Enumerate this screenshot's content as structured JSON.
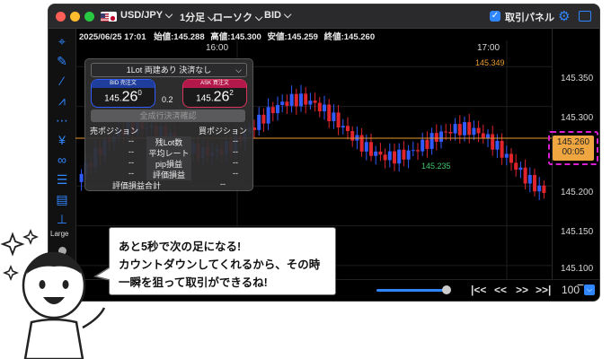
{
  "titlebar": {
    "symbol": "USD/JPY",
    "timeframe": "1分足",
    "chart_type": "ローソク",
    "price_side": "BID",
    "trade_panel_label": "取引パネル",
    "trade_panel_checked": true
  },
  "infobar": {
    "datetime": "2025/06/25 17:01",
    "open": "始値:145.288",
    "high": "高値:145.300",
    "low": "安値:145.259",
    "close": "終値:145.260"
  },
  "time_axis": [
    "16:00",
    "17:00"
  ],
  "price_axis": [
    "145.350",
    "145.300",
    "145.200",
    "145.150",
    "145.100"
  ],
  "chart_annotations": {
    "high": "145.349",
    "low": "145.235"
  },
  "current_price": {
    "price": "145.260",
    "countdown": "00:05"
  },
  "panel": {
    "mode": "1Lot 両建あり 決済なし",
    "bid_label": "BID 売注文",
    "bid_big": "145.",
    "bid_pips": "26",
    "bid_frac": "0",
    "spread": "0.2",
    "ask_label": "ASK 買注文",
    "ask_big": "145.",
    "ask_pips": "26",
    "ask_frac": "2",
    "close_all": "全成行決済確認",
    "sell_position": "売ポジション",
    "buy_position": "買ポジション",
    "rows": [
      {
        "label": "残Lot数",
        "sell": "--",
        "buy": "--"
      },
      {
        "label": "平均レート",
        "sell": "--",
        "buy": "--"
      },
      {
        "label": "pip損益",
        "sell": "--",
        "buy": "--"
      },
      {
        "label": "評価損益",
        "sell": "--",
        "buy": "--"
      }
    ],
    "total_label": "評価損益合計",
    "total_value": "--"
  },
  "sidebar": {
    "size_label": "Large"
  },
  "bottombar": {
    "zoom": "100"
  },
  "bubble": {
    "lines": [
      "あと5秒で次の足になる!",
      "カウントダウンしてくれるから、その時",
      "一瞬を狙って取引ができるね!"
    ]
  },
  "colors": {
    "up": "#2f5bff",
    "down": "#e0242c",
    "price_line": "#e89a32",
    "highlight_box": "#d81fd0",
    "accent": "#2f86ff"
  },
  "chart_data": {
    "type": "candlestick",
    "y_range": [
      145.083,
      145.383
    ],
    "x_range": [
      "15:35",
      "17:01"
    ],
    "series": []
  }
}
